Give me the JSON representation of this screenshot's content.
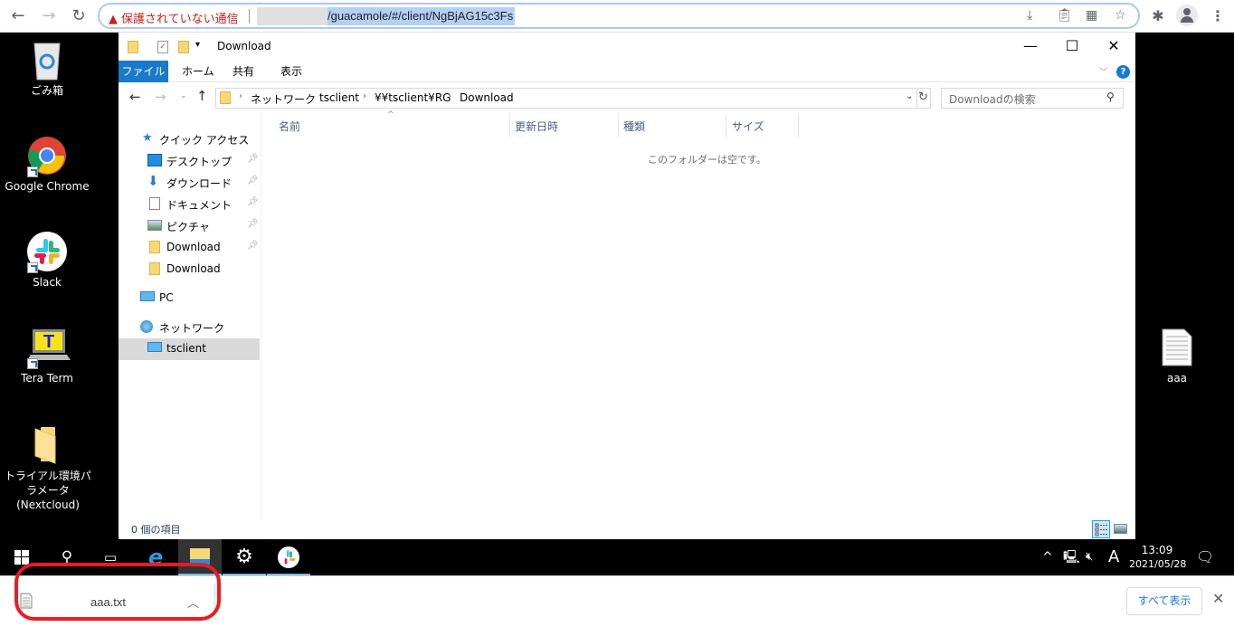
{
  "browser": {
    "security_warning": "保護されていない通信",
    "url": "/guacamole/#/client/NgBjAG15c3Fs",
    "icons": [
      "back-icon",
      "forward-icon",
      "reload-icon",
      "download-icon",
      "clipboard-icon",
      "qr-icon",
      "star-icon",
      "extensions-icon",
      "profile-icon",
      "menu-icon"
    ]
  },
  "desktop": {
    "icons": [
      {
        "label": "ごみ箱",
        "icon": "recycle-bin-icon"
      },
      {
        "label": "Google Chrome",
        "icon": "chrome-icon"
      },
      {
        "label": "Slack",
        "icon": "slack-icon"
      },
      {
        "label": "Tera Term",
        "icon": "teraterm-icon"
      },
      {
        "label": "トライアル環境パラメータ(Nextcloud)",
        "icon": "folder-icon"
      },
      {
        "label": "aaa",
        "icon": "text-file-icon"
      }
    ]
  },
  "explorer": {
    "title": "Download",
    "ribbon_tabs": [
      "ファイル",
      "ホーム",
      "共有",
      "表示"
    ],
    "breadcrumb": [
      "ネットワーク",
      "tsclient",
      "¥¥tsclient¥RG",
      "Download"
    ],
    "search_placeholder": "Downloadの検索",
    "nav": {
      "quick_access": "クイック アクセス",
      "items": [
        {
          "label": "デスクトップ",
          "pinned": true
        },
        {
          "label": "ダウンロード",
          "pinned": true
        },
        {
          "label": "ドキュメント",
          "pinned": true
        },
        {
          "label": "ピクチャ",
          "pinned": true
        },
        {
          "label": "Download",
          "pinned": true
        },
        {
          "label": "Download",
          "pinned": false
        }
      ],
      "pc": "PC",
      "network": "ネットワーク",
      "tsclient": "tsclient"
    },
    "columns": [
      "名前",
      "更新日時",
      "種類",
      "サイズ"
    ],
    "empty_message": "このフォルダーは空です。",
    "status": "0 個の項目"
  },
  "taskbar": {
    "time": "13:09",
    "date": "2021/05/28",
    "ime": "A"
  },
  "download_shelf": {
    "file_name": "aaa.txt",
    "show_all": "すべて表示"
  },
  "annotation_color": "#e81c24"
}
